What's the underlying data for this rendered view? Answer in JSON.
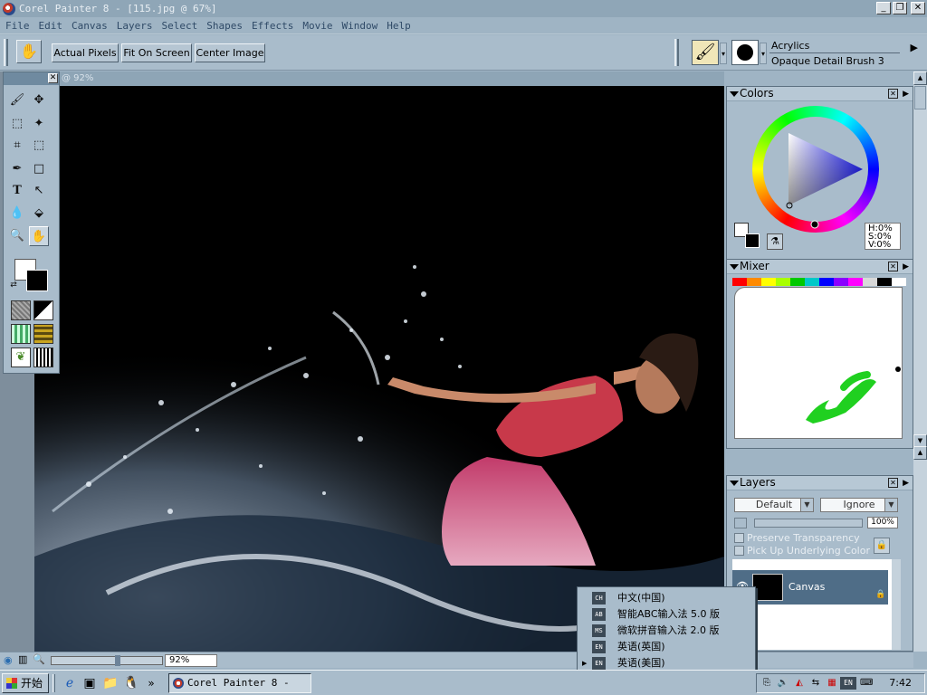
{
  "window": {
    "title": "Corel Painter 8 - [115.jpg @ 67%]",
    "minimize": "_",
    "restore": "❐",
    "close": "✕"
  },
  "menu": [
    "File",
    "Edit",
    "Canvas",
    "Layers",
    "Select",
    "Shapes",
    "Effects",
    "Movie",
    "Window",
    "Help"
  ],
  "propbar": {
    "actual_pixels": "Actual Pixels",
    "fit_on_screen": "Fit On Screen",
    "center_image": "Center Image",
    "brush_category": "Acrylics",
    "brush_variant": "Opaque Detail Brush 3"
  },
  "document": {
    "zoom_caption": "@ 92%"
  },
  "colors_panel": {
    "title": "Colors",
    "h": "H:0%",
    "s": "S:0%",
    "v": "V:0%"
  },
  "mixer_panel": {
    "title": "Mixer",
    "swatches": [
      "#ff0000",
      "#ff8a00",
      "#ffff00",
      "#a8ff00",
      "#00c800",
      "#00c8c8",
      "#0000ff",
      "#8a00ff",
      "#ff00ff",
      "#d8d8d8",
      "#000000",
      "#ffffff"
    ]
  },
  "layers_panel": {
    "title": "Layers",
    "composite_method": "Default",
    "depth": "Ignore",
    "opacity": "100%",
    "preserve_transparency": "Preserve Transparency",
    "pick_up_color": "Pick Up Underlying Color",
    "layer_name": "Canvas"
  },
  "statusbar": {
    "zoom": "92%"
  },
  "ime_menu": [
    {
      "code": "CH",
      "label": "中文(中国)"
    },
    {
      "code": "AB",
      "label": "智能ABC输入法 5.0 版"
    },
    {
      "code": "MS",
      "label": "微软拼音输入法 2.0 版"
    },
    {
      "code": "EN",
      "label": "英语(英国)"
    },
    {
      "code": "EN",
      "label": "英语(美国)"
    }
  ],
  "taskbar": {
    "start": "开始",
    "task_item": "Corel Painter 8 - [...",
    "chevron": "»",
    "tray_lang": "EN",
    "clock": "7:42"
  }
}
